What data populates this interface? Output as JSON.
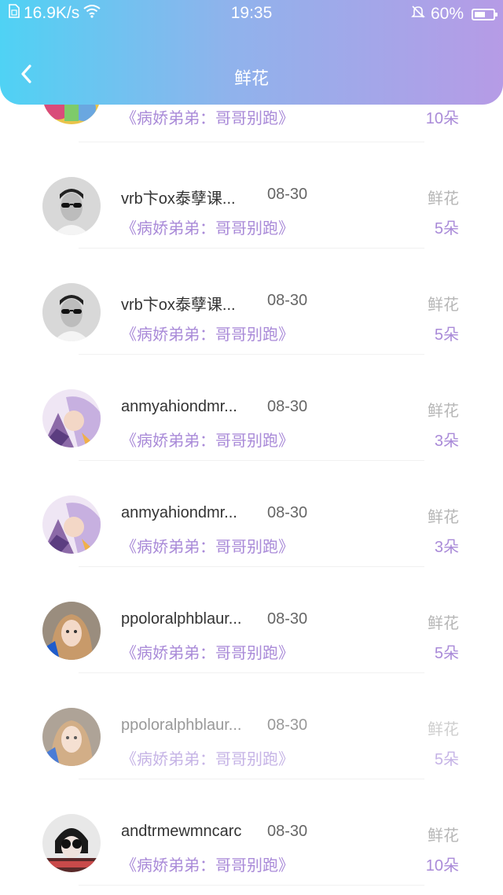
{
  "status_bar": {
    "net_speed": "16.9K/s",
    "time": "19:35",
    "battery_percent": "60%",
    "battery_level": 0.6,
    "icons": [
      "sim-icon",
      "wifi-icon",
      "bell-mute-icon",
      "battery-icon"
    ]
  },
  "header": {
    "title": "鲜花",
    "back_icon": "chevron-left-icon",
    "gradient": [
      "#4fd2f4",
      "#b69be6"
    ]
  },
  "list": [
    {
      "name": "",
      "date": "",
      "book": "《病娇弟弟：哥哥别跑》",
      "label": "",
      "count": "10朵",
      "avatar": "avatar-colorful"
    },
    {
      "name": "vrb卞ox泰孽课...",
      "date": "08-30",
      "book": "《病娇弟弟：哥哥别跑》",
      "label": "鲜花",
      "count": "5朵",
      "avatar": "avatar-man-sunglasses"
    },
    {
      "name": "vrb卞ox泰孽课...",
      "date": "08-30",
      "book": "《病娇弟弟：哥哥别跑》",
      "label": "鲜花",
      "count": "5朵",
      "avatar": "avatar-man-sunglasses"
    },
    {
      "name": "anmyahiondmr...",
      "date": "08-30",
      "book": "《病娇弟弟：哥哥别跑》",
      "label": "鲜花",
      "count": "3朵",
      "avatar": "avatar-anime"
    },
    {
      "name": "anmyahiondmr...",
      "date": "08-30",
      "book": "《病娇弟弟：哥哥别跑》",
      "label": "鲜花",
      "count": "3朵",
      "avatar": "avatar-anime"
    },
    {
      "name": "ppoloralphblaur...",
      "date": "08-30",
      "book": "《病娇弟弟：哥哥别跑》",
      "label": "鲜花",
      "count": "5朵",
      "avatar": "avatar-woman"
    },
    {
      "name": "ppoloralphblaur...",
      "date": "08-30",
      "book": "《病娇弟弟：哥哥别跑》",
      "label": "鲜花",
      "count": "5朵",
      "avatar": "avatar-woman"
    },
    {
      "name": "andtrmewmncarc",
      "date": "08-30",
      "book": "《病娇弟弟：哥哥别跑》",
      "label": "鲜花",
      "count": "10朵",
      "avatar": "avatar-sunglasses-dark"
    }
  ],
  "colors": {
    "accent": "#a98ad8",
    "muted": "#b6b6b6"
  }
}
